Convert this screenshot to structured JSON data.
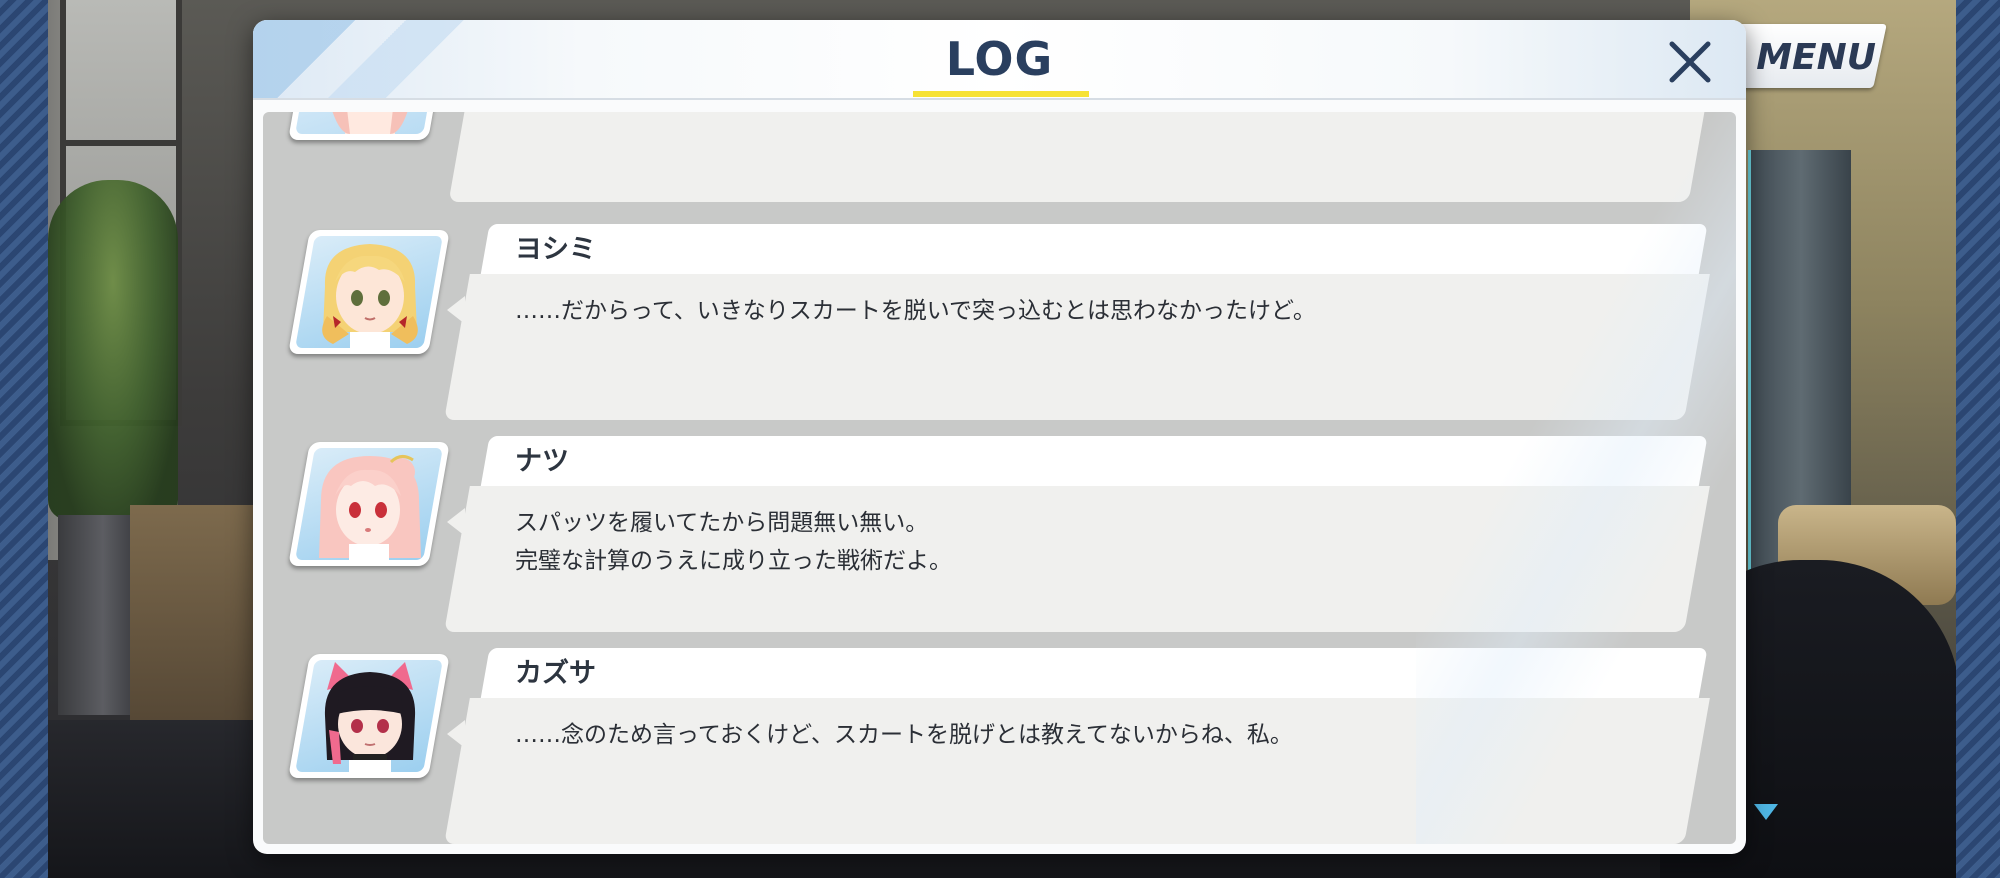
{
  "header": {
    "title": "LOG",
    "menu_label": "MENU"
  },
  "colors": {
    "title": "#2a3f5f",
    "accent_underline": "#f6e235",
    "bubble": "#f0f0ee",
    "panel": "#c8c9c8"
  },
  "entries": [
    {
      "name": "ヨシミ",
      "lines": [
        "……だからって、いきなりスカートを脱いで突っ込むとは思わなかったけど。"
      ],
      "avatar": "yoshimi-portrait"
    },
    {
      "name": "ナツ",
      "lines": [
        "スパッツを履いてたから問題無い無い。",
        "完璧な計算のうえに成り立った戦術だよ。"
      ],
      "avatar": "natsu-portrait"
    },
    {
      "name": "カズサ",
      "lines": [
        "……念のため言っておくけど、スカートを脱げとは教えてないからね、私。"
      ],
      "avatar": "kazusa-portrait"
    }
  ],
  "icons": {
    "close": "close-icon"
  }
}
